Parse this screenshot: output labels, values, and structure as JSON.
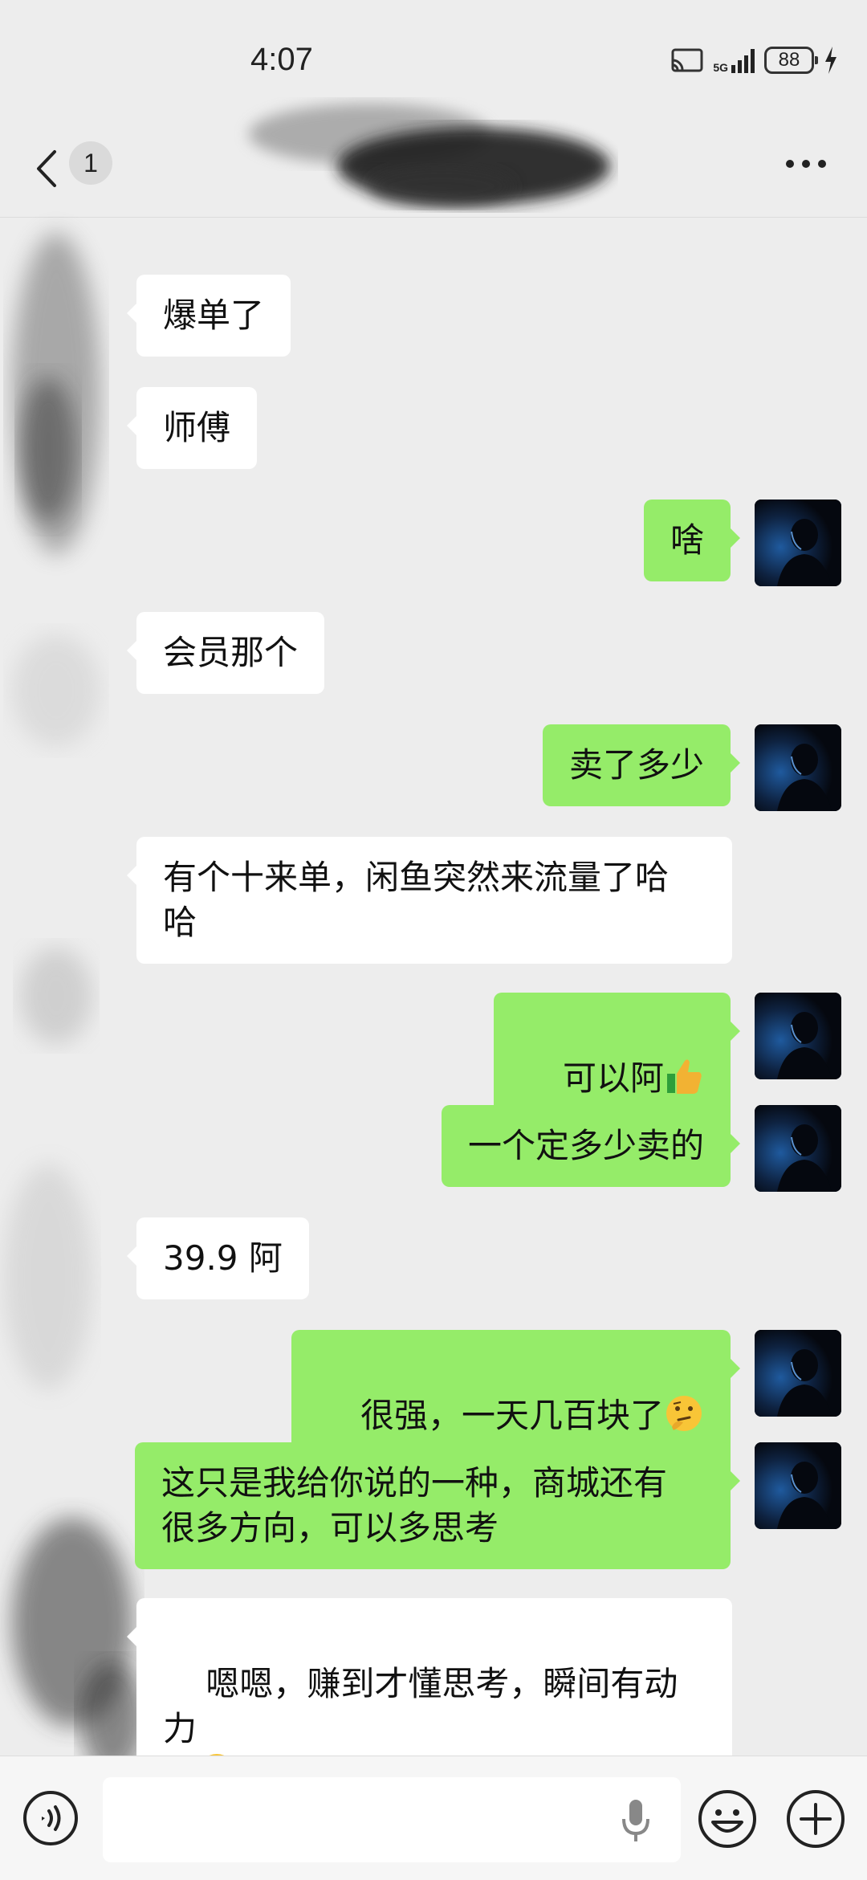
{
  "status_bar": {
    "time": "4:07",
    "network": "5G",
    "battery": "88"
  },
  "nav": {
    "unread_count": "1",
    "back_icon": "chevron-left-icon",
    "more_icon": "more-horizontal-icon"
  },
  "messages": [
    {
      "side": "in",
      "text": "爆单了"
    },
    {
      "side": "in",
      "text": "师傅"
    },
    {
      "side": "out",
      "text": "啥"
    },
    {
      "side": "in",
      "text": "会员那个"
    },
    {
      "side": "out",
      "text": "卖了多少"
    },
    {
      "side": "in",
      "text": "有个十来单，闲鱼突然来流量了哈\n哈"
    },
    {
      "side": "out",
      "text": "可以阿",
      "emoji": "thumbs-up-emoji"
    },
    {
      "side": "out",
      "text": "一个定多少卖的"
    },
    {
      "side": "in",
      "text": "39.9 阿"
    },
    {
      "side": "out",
      "text": "很强，一天几百块了",
      "emoji": "thinking-emoji"
    },
    {
      "side": "out",
      "text": "这只是我给你说的一种，商城还有\n很多方向，可以多思考"
    },
    {
      "side": "in",
      "text": "嗯嗯，赚到才懂思考，瞬间有动力\n了",
      "emoji": "grin-emoji"
    }
  ],
  "input_bar": {
    "value": "",
    "icons": [
      "voice-icon",
      "microphone-icon",
      "emoji-icon",
      "plus-icon"
    ]
  },
  "colors": {
    "background": "#ededed",
    "outgoing_bubble": "#95ec69",
    "incoming_bubble": "#ffffff"
  }
}
